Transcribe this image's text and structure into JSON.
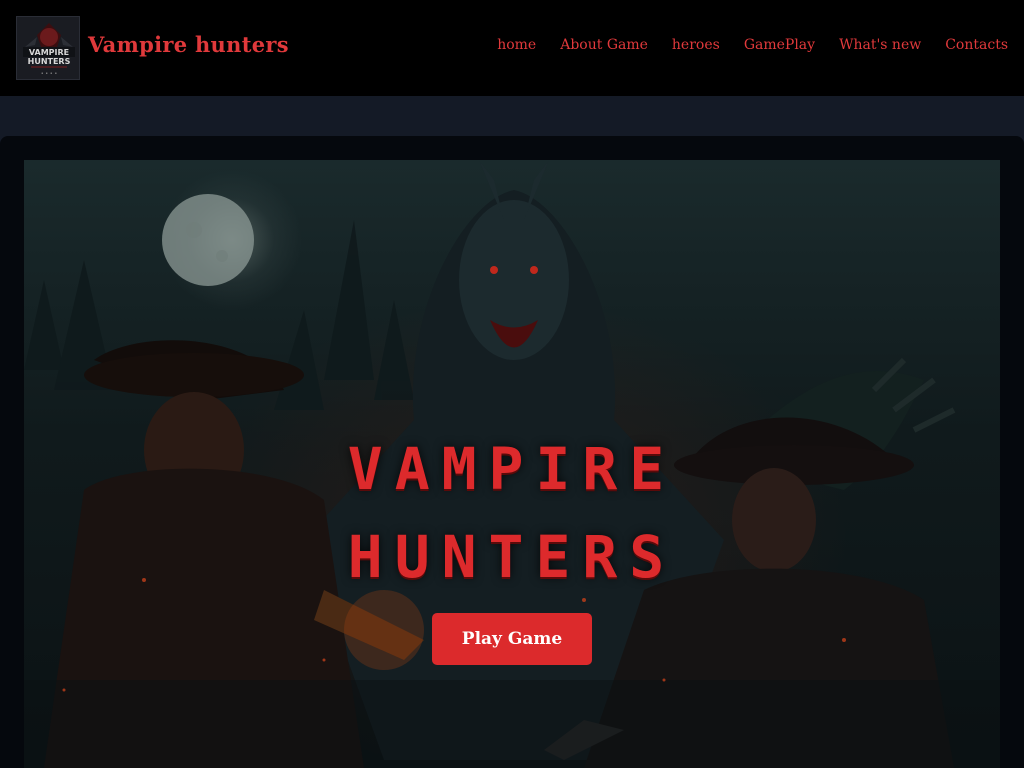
{
  "brand": {
    "name": "Vampire hunters",
    "logo_text": "VAMPIRE HUNTERS"
  },
  "nav": {
    "items": [
      "home",
      "About Game",
      "heroes",
      "GamePlay",
      "What's new",
      "Contacts"
    ]
  },
  "hero": {
    "title_line1": "VAMPIRE",
    "title_line2": "HUNTERS",
    "cta_label": "Play Game"
  },
  "colors": {
    "accent": "#dc2a2c",
    "header_bg": "#000000",
    "page_bg": "#141a26"
  }
}
